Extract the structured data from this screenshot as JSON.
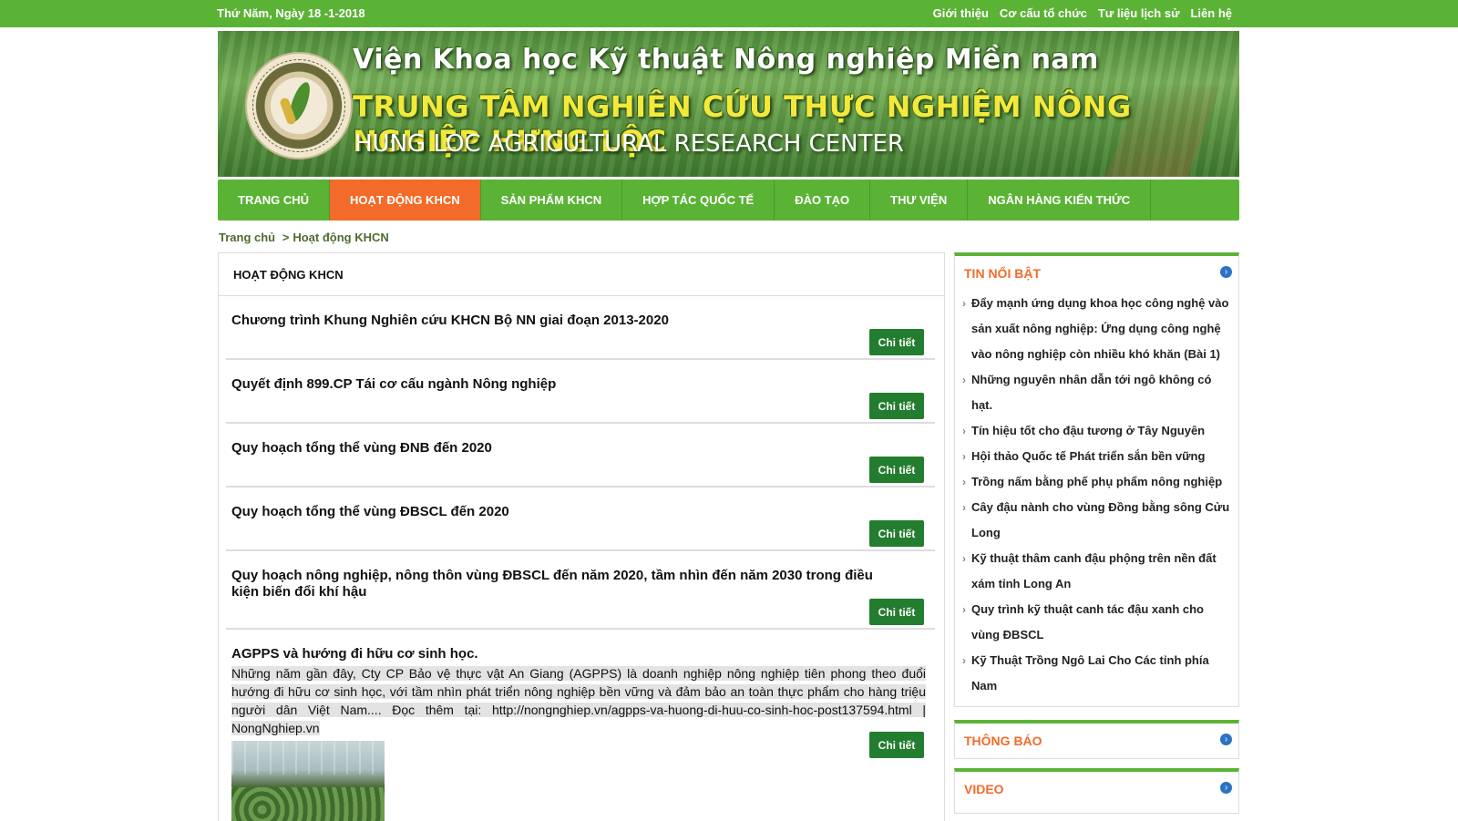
{
  "topbar": {
    "date": "Thứ Năm, Ngày 18 -1-2018",
    "links": [
      "Giới thiệu",
      "Cơ cấu tổ chức",
      "Tư liệu lịch sử",
      "Liên hệ"
    ]
  },
  "banner": {
    "line1": "Viện Khoa học Kỹ thuật Nông nghiệp Miền nam",
    "line2": "TRUNG TÂM NGHIÊN CỨU THỰC NGHIỆM NÔNG NGHIỆP HƯNG LỘC",
    "line3": "HUNG LOC AGRICULTURAL RESEARCH CENTER",
    "logo_text": "TRUNG TÂM NGHIÊN CỨU NÔNG NGHIỆP HƯNG LỘC"
  },
  "nav": {
    "items": [
      "TRANG CHỦ",
      "HOẠT ĐỘNG KHCN",
      "SẢN PHẨM KHCN",
      "HỢP TÁC QUỐC TẾ",
      "ĐÀO TẠO",
      "THƯ VIỆN",
      "NGÂN HÀNG KIẾN THỨC"
    ],
    "active_index": 1
  },
  "breadcrumb": {
    "home": "Trang chủ",
    "sep": ">",
    "current": "Hoạt động KHCN"
  },
  "main": {
    "heading": "HOẠT ĐỘNG KHCN",
    "button_label": "Chi tiết",
    "posts": [
      {
        "title": "Chương trình Khung Nghiên cứu KHCN Bộ NN giai đoạn 2013-2020"
      },
      {
        "title": "Quyết định 899.CP Tái cơ cấu ngành Nông nghiệp"
      },
      {
        "title": "Quy hoạch tổng thể vùng ĐNB đến 2020"
      },
      {
        "title": "Quy hoạch tổng thể vùng ĐBSCL đến 2020"
      },
      {
        "title": "Quy hoạch nông nghiệp, nông thôn vùng ĐBSCL đến năm 2020, tầm nhìn đến năm 2030 trong điều kiện biến đổi khí hậu"
      },
      {
        "title": "AGPPS và hướng đi hữu cơ sinh học.",
        "desc": "Những năm gần đây, Cty CP Bảo vệ thực vật An Giang (AGPPS) là doanh nghiệp nông nghiệp tiên phong theo đuổi hướng đi hữu cơ sinh học, với tầm nhìn phát triển nông nghiệp bền vững và đảm bảo an toàn thực phẩm cho hàng triệu người dân Việt Nam.... Đọc thêm tại: http://nongnghiep.vn/agpps-va-huong-di-huu-co-sinh-hoc-post137594.html | NongNghiep.vn"
      }
    ]
  },
  "sidebar": {
    "featured": {
      "title": "TIN NỔI BẬT",
      "items": [
        "Đẩy mạnh ứng dụng khoa học công nghệ vào sản xuất nông nghiệp: Ứng dụng công nghệ vào nông nghiệp còn nhiều khó khăn (Bài 1)",
        "Những nguyên nhân dẫn tới ngô không có hạt.",
        "Tín hiệu tốt cho đậu tương ở Tây Nguyên",
        "Hội thảo Quốc tế Phát triển sắn bền vững",
        "Trồng nấm bằng phế phụ phẩm nông nghiệp",
        "Cây đậu nành cho vùng Đồng bằng sông Cửu Long",
        "Kỹ thuật thâm canh đậu phộng trên nền đất xám tỉnh Long An",
        "Quy trình kỹ thuật canh tác đậu xanh cho vùng ĐBSCL",
        "Kỹ Thuật Trồng Ngô Lai Cho Các tỉnh phía Nam"
      ]
    },
    "notice": {
      "title": "THÔNG BÁO"
    },
    "video": {
      "title": "VIDEO"
    }
  }
}
